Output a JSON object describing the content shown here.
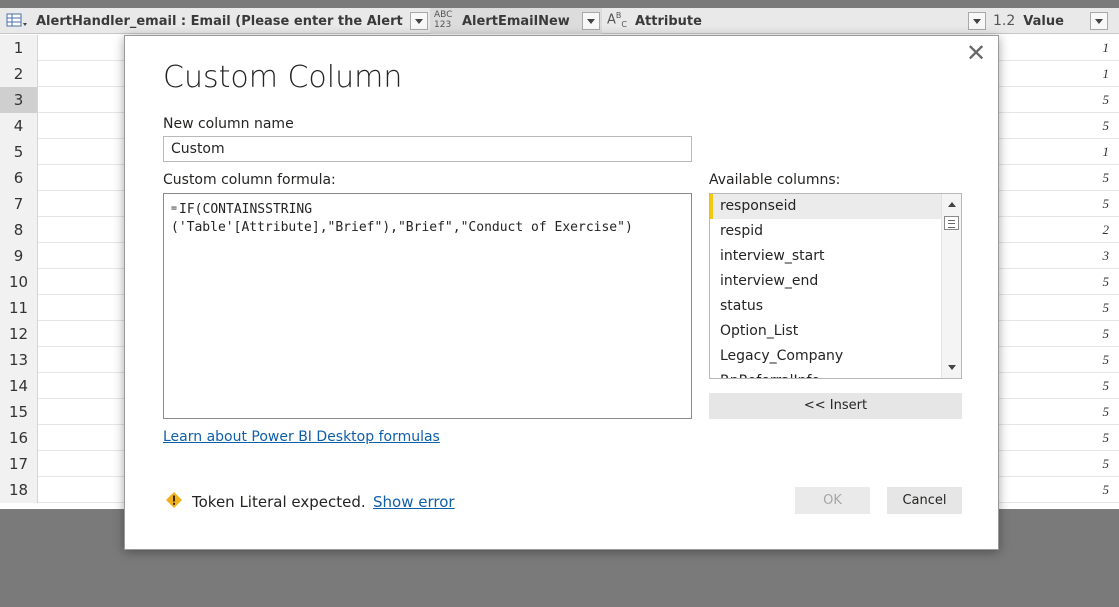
{
  "grid": {
    "columns": [
      {
        "name": "col-alerthandler",
        "label": "AlertHandler_email : Email (Please enter the Alert Handl...",
        "type_icon": "table-icon"
      },
      {
        "name": "col-alertemailnew",
        "label": "AlertEmailNew",
        "type_icon_top": "ABC",
        "type_icon_bottom": "123"
      },
      {
        "name": "col-attribute",
        "label": "Attribute",
        "type_icon_top": "A",
        "type_icon_bottom": "B C"
      },
      {
        "name": "col-value",
        "label": "Value",
        "type_icon": "1.2"
      }
    ],
    "rows": [
      {
        "num": "1",
        "value": "1"
      },
      {
        "num": "2",
        "value": "1"
      },
      {
        "num": "3",
        "value": "5"
      },
      {
        "num": "4",
        "value": "5"
      },
      {
        "num": "5",
        "value": "1"
      },
      {
        "num": "6",
        "value": "5"
      },
      {
        "num": "7",
        "value": "5"
      },
      {
        "num": "8",
        "value": "2"
      },
      {
        "num": "9",
        "value": "3"
      },
      {
        "num": "10",
        "value": "5"
      },
      {
        "num": "11",
        "value": "5"
      },
      {
        "num": "12",
        "value": "5"
      },
      {
        "num": "13",
        "value": "5"
      },
      {
        "num": "14",
        "value": "5"
      },
      {
        "num": "15",
        "value": "5"
      },
      {
        "num": "16",
        "value": "5"
      },
      {
        "num": "17",
        "value": "5"
      },
      {
        "num": "18",
        "value": "5"
      }
    ],
    "selected_row": "3"
  },
  "dialog": {
    "title": "Custom Column",
    "close_glyph": "✕",
    "new_column_label": "New column name",
    "new_column_value": "Custom",
    "formula_label": "Custom column formula:",
    "formula_eq": "=",
    "formula_line1": "IF(CONTAINSSTRING",
    "formula_line2": "('Table'[Attribute],\"Brief\"),\"Brief\",\"Conduct of Exercise\")",
    "available_label": "Available columns:",
    "available_columns": [
      "responseid",
      "respid",
      "interview_start",
      "interview_end",
      "status",
      "Option_List",
      "Legacy_Company",
      "RpRoferralInfo"
    ],
    "insert_label": "<< Insert",
    "learn_link": "Learn about Power BI Desktop formulas",
    "error_text": "Token Literal expected.",
    "show_error_link": "Show error",
    "ok_label": "OK",
    "cancel_label": "Cancel"
  },
  "colors": {
    "accent": "#f2c811",
    "link": "#0f5fa8",
    "warning": "#f2b01e"
  }
}
